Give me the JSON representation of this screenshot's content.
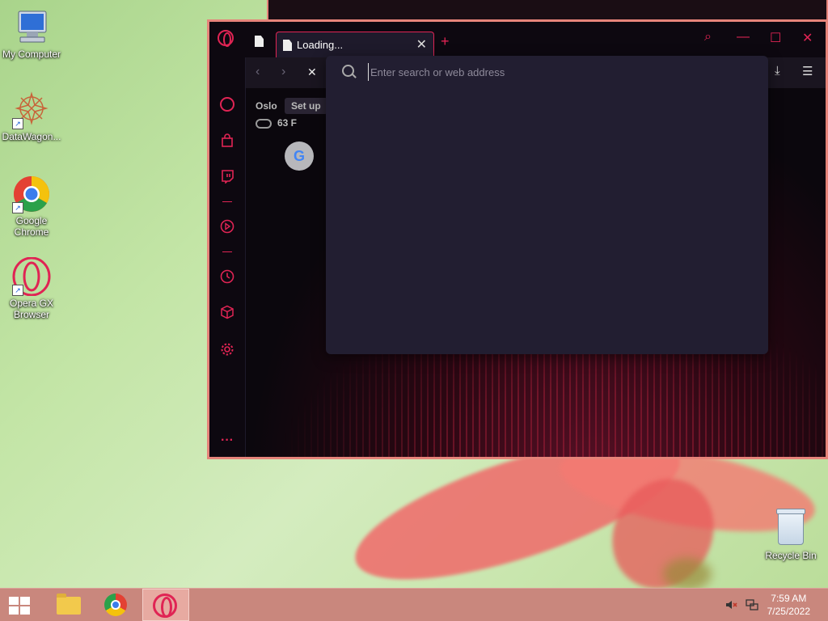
{
  "desktop": {
    "icons": [
      {
        "label": "My Computer"
      },
      {
        "label": "DataWagon..."
      },
      {
        "label": "Google Chrome"
      },
      {
        "label": "Opera GX Browser"
      },
      {
        "label": "Recycle Bin"
      }
    ]
  },
  "browser": {
    "tab": {
      "title": "Loading...",
      "close_glyph": "✕"
    },
    "new_tab_glyph": "+",
    "window_controls": {
      "search": "⌕",
      "minimize": "—",
      "maximize": "☐",
      "close": "✕"
    },
    "nav": {
      "back": "‹",
      "forward": "›",
      "stop": "✕",
      "downloads": "⤓",
      "easy_setup": "☰"
    },
    "address_bar": {
      "value": "",
      "placeholder": "Enter search or web address"
    },
    "start_page": {
      "city": "Oslo",
      "setup_button": "Set up",
      "temperature": "63 F",
      "speed_dial": [
        {
          "label": "G",
          "name": "Google"
        }
      ]
    },
    "sidebar": {
      "items": [
        "speedometer-icon",
        "shopping-bag-icon",
        "twitch-icon",
        "player-icon",
        "history-icon",
        "extensions-icon",
        "settings-icon",
        "more-icon"
      ],
      "more_glyph": "···"
    },
    "accent_color": "#e02454",
    "border_color": "#e6847a"
  },
  "taskbar": {
    "pinned": [
      "start-button",
      "file-explorer",
      "google-chrome",
      "opera-gx"
    ],
    "active": "opera-gx",
    "clock": {
      "time": "7:59 AM",
      "date": "7/25/2022"
    }
  }
}
